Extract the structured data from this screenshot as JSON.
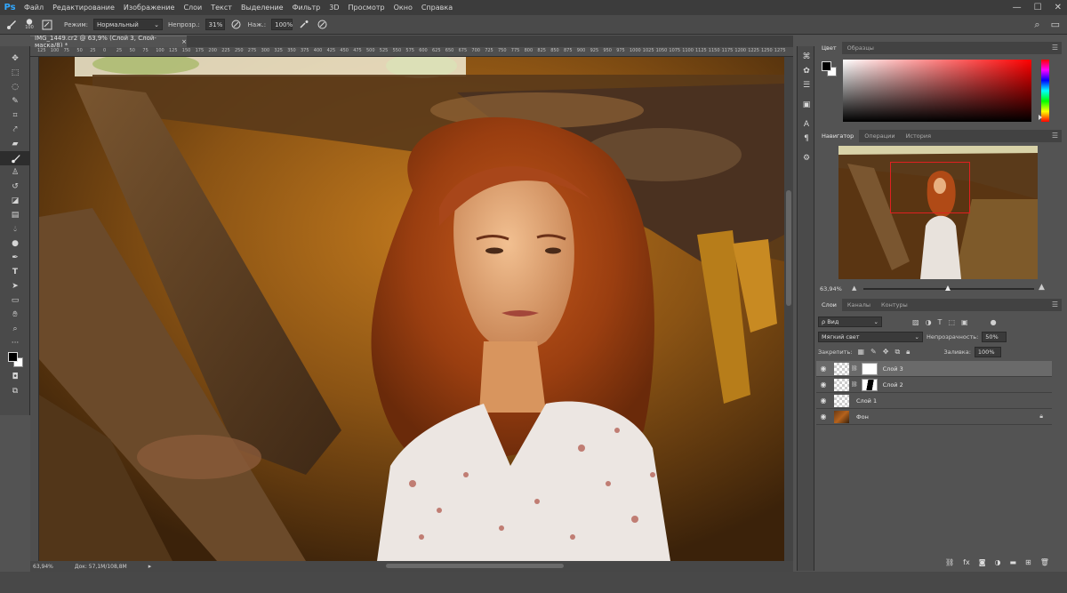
{
  "app": {
    "logo": "Ps"
  },
  "menu": [
    "Файл",
    "Редактирование",
    "Изображение",
    "Слои",
    "Текст",
    "Выделение",
    "Фильтр",
    "3D",
    "Просмотр",
    "Окно",
    "Справка"
  ],
  "window_controls": {
    "minimize": "—",
    "maximize": "☐",
    "close": "✕"
  },
  "options": {
    "brush_size": "100",
    "mode_label": "Режим:",
    "mode_value": "Нормальный",
    "opacity_label": "Непрозр.:",
    "opacity_value": "31%",
    "flow_label": "Наж.:",
    "flow_value": "100%"
  },
  "document": {
    "tab_title": "IMG_1449.cr2 @ 63,9% (Слой 3, Слой-маска/8) *",
    "tab_close": "×",
    "ruler_ticks": [
      "125",
      "100",
      "75",
      "50",
      "25",
      "0",
      "25",
      "50",
      "75",
      "100",
      "125",
      "150",
      "175",
      "200",
      "225",
      "250",
      "275",
      "300",
      "325",
      "350",
      "375",
      "400",
      "425",
      "450",
      "475",
      "500",
      "525",
      "550",
      "575",
      "600",
      "625",
      "650",
      "675",
      "700",
      "725",
      "750",
      "775",
      "800",
      "825",
      "850",
      "875",
      "900",
      "925",
      "950",
      "975",
      "1000",
      "1025",
      "1050",
      "1075",
      "1100",
      "1125",
      "1150",
      "1175",
      "1200",
      "1225",
      "1250",
      "1275"
    ]
  },
  "status": {
    "zoom": "63,94%",
    "doc_size": "Док: 57,1M/108,8M"
  },
  "color_panel": {
    "tabs": [
      "Цвет",
      "Образцы"
    ],
    "active": "Цвет"
  },
  "navigator_panel": {
    "tabs": [
      "Навигатор",
      "Операции",
      "История"
    ],
    "active": "Навигатор",
    "zoom": "63,94%"
  },
  "layers_panel": {
    "tabs": [
      "Слои",
      "Каналы",
      "Контуры"
    ],
    "active": "Слои",
    "filter_kind": "ρ Вид",
    "blend_mode": "Мягкий свет",
    "opacity_label": "Непрозрачность:",
    "opacity_value": "50%",
    "lock_label": "Закрепить:",
    "fill_label": "Заливка:",
    "fill_value": "100%",
    "layers": [
      {
        "name": "Слой 3",
        "selected": true
      },
      {
        "name": "Слой 2",
        "selected": false
      },
      {
        "name": "Слой 1",
        "selected": false
      },
      {
        "name": "Фон",
        "selected": false
      }
    ]
  },
  "icons": {
    "tools": [
      "move-icon",
      "marquee-icon",
      "lasso-icon",
      "quick-select-icon",
      "crop-icon",
      "eyedropper-icon",
      "healing-icon",
      "brush-icon",
      "stamp-icon",
      "history-brush-icon",
      "eraser-icon",
      "gradient-icon",
      "blur-icon",
      "dodge-icon",
      "pen-icon",
      "type-icon",
      "path-select-icon",
      "rectangle-icon",
      "hand-icon",
      "zoom-icon",
      "more-tools-icon"
    ]
  }
}
